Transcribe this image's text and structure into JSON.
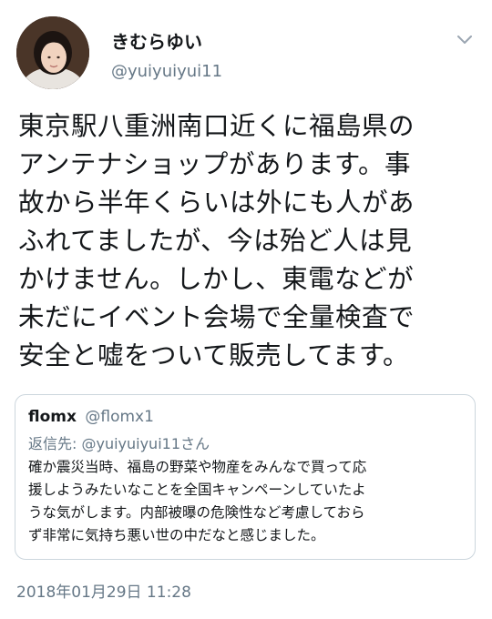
{
  "tweet": {
    "author_name": "きむらゆい",
    "author_handle": "@yuiyuiyui11",
    "text": "東京駅八重洲南口近くに福島県の\nアンテナショップがあります。事\n故から半年くらいは外にも人があ\nふれてましたが、今は殆ど人は見\nかけません。しかし、東電などが\n未だにイベント会場で全量検査で\n安全と嘘をついて販売してます。",
    "timestamp": "2018年01月29日 11:28"
  },
  "quoted": {
    "author_name": "flomx",
    "author_handle": "@flomx1",
    "reply_to": "返信先: @yuiyuiyui11さん",
    "text": "確か震災当時、福島の野菜や物産をみんなで買って応\n援しようみたいなことを全国キャンペーンしていたよ\nうな気がします。内部被曝の危険性など考慮しておら\nず非常に気持ち悪い世の中だなと感じました。"
  },
  "icons": {
    "menu": "chevron-down-icon",
    "avatar": "avatar"
  },
  "colors": {
    "text": "#14171a",
    "muted": "#657786",
    "border": "#ccd6dd"
  }
}
